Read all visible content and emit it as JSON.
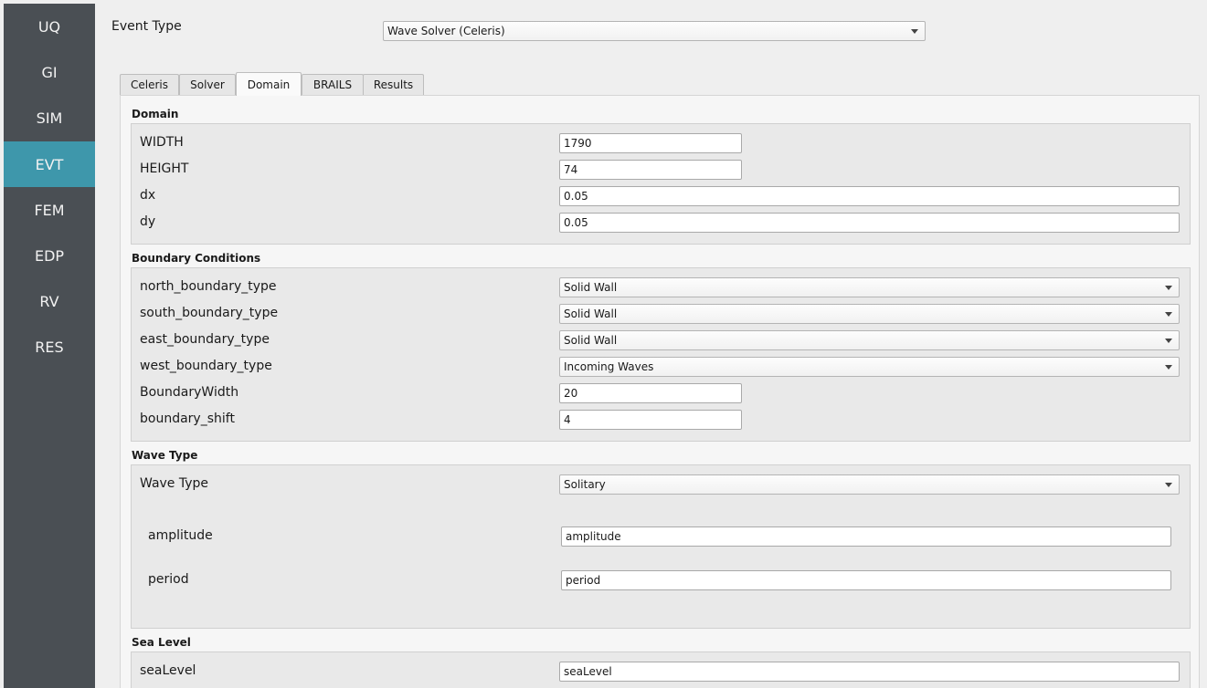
{
  "sidebar": {
    "items": [
      {
        "label": "UQ"
      },
      {
        "label": "GI"
      },
      {
        "label": "SIM"
      },
      {
        "label": "EVT"
      },
      {
        "label": "FEM"
      },
      {
        "label": "EDP"
      },
      {
        "label": "RV"
      },
      {
        "label": "RES"
      }
    ],
    "active": "EVT"
  },
  "header": {
    "event_type_label": "Event Type",
    "event_type_value": "Wave Solver (Celeris)"
  },
  "tabs": [
    {
      "label": "Celeris"
    },
    {
      "label": "Solver"
    },
    {
      "label": "Domain"
    },
    {
      "label": "BRAILS"
    },
    {
      "label": "Results"
    }
  ],
  "active_tab": "Domain",
  "domain": {
    "title": "Domain",
    "width": {
      "label": "WIDTH",
      "value": "1790"
    },
    "height": {
      "label": "HEIGHT",
      "value": "74"
    },
    "dx": {
      "label": "dx",
      "value": "0.05"
    },
    "dy": {
      "label": "dy",
      "value": "0.05"
    }
  },
  "boundary": {
    "title": "Boundary Conditions",
    "north": {
      "label": "north_boundary_type",
      "value": "Solid Wall"
    },
    "south": {
      "label": "south_boundary_type",
      "value": "Solid Wall"
    },
    "east": {
      "label": "east_boundary_type",
      "value": "Solid Wall"
    },
    "west": {
      "label": "west_boundary_type",
      "value": "Incoming Waves"
    },
    "width": {
      "label": "BoundaryWidth",
      "value": "20"
    },
    "shift": {
      "label": "boundary_shift",
      "value": "4"
    }
  },
  "wave": {
    "title": "Wave Type",
    "type": {
      "label": "Wave Type",
      "value": "Solitary"
    },
    "amplitude": {
      "label": "amplitude",
      "value": "amplitude"
    },
    "period": {
      "label": "period",
      "value": "period"
    }
  },
  "sea": {
    "title": "Sea Level",
    "level": {
      "label": "seaLevel",
      "value": "seaLevel"
    }
  },
  "colors": {
    "sidebar_bg": "#4a4f54",
    "active_nav": "#3e97ab"
  }
}
